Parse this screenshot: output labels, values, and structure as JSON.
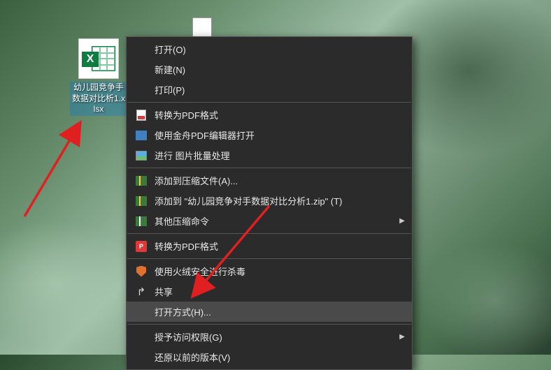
{
  "desktop": {
    "file_icon": {
      "label": "幼儿园竞争手数据对比析1.xlsx",
      "type": "excel-file",
      "logo_text": "X"
    }
  },
  "context_menu": {
    "items": [
      {
        "id": "open",
        "label": "打开(O)",
        "icon": null,
        "submenu": false
      },
      {
        "id": "new",
        "label": "新建(N)",
        "icon": null,
        "submenu": false
      },
      {
        "id": "print",
        "label": "打印(P)",
        "icon": null,
        "submenu": false
      },
      {
        "id": "sep1",
        "separator": true
      },
      {
        "id": "convert-pdf",
        "label": "转换为PDF格式",
        "icon": "pdf-white-icon",
        "submenu": false
      },
      {
        "id": "open-jinzhou",
        "label": "使用金舟PDF编辑器打开",
        "icon": "pdf-blue-icon",
        "submenu": false
      },
      {
        "id": "batch-image",
        "label": "进行 图片批量处理",
        "icon": "image-icon",
        "submenu": false
      },
      {
        "id": "sep2",
        "separator": true
      },
      {
        "id": "add-archive",
        "label": "添加到压缩文件(A)...",
        "icon": "archive-icon",
        "submenu": false
      },
      {
        "id": "add-archive-named",
        "label": "添加到 \"幼儿园竞争对手数据对比分析1.zip\" (T)",
        "icon": "archive-icon",
        "submenu": false
      },
      {
        "id": "other-archive",
        "label": "其他压缩命令",
        "icon": "archive-icon-2",
        "submenu": true
      },
      {
        "id": "sep3",
        "separator": true
      },
      {
        "id": "convert-pdf-2",
        "label": "转换为PDF格式",
        "icon": "pdf-red-icon",
        "submenu": false
      },
      {
        "id": "sep4",
        "separator": true
      },
      {
        "id": "huorong-scan",
        "label": "使用火绒安全进行杀毒",
        "icon": "shield-icon",
        "submenu": false
      },
      {
        "id": "share",
        "label": "共享",
        "icon": "share-icon",
        "submenu": false
      },
      {
        "id": "open-with",
        "label": "打开方式(H)...",
        "icon": null,
        "submenu": false,
        "highlighted": true
      },
      {
        "id": "sep5",
        "separator": true
      },
      {
        "id": "grant-access",
        "label": "授予访问权限(G)",
        "icon": null,
        "submenu": true
      },
      {
        "id": "restore-version",
        "label": "还原以前的版本(V)",
        "icon": null,
        "submenu": false
      }
    ]
  },
  "annotations": {
    "arrow1_target": "desktop-file-icon",
    "arrow2_target": "open-with-menu-item"
  }
}
